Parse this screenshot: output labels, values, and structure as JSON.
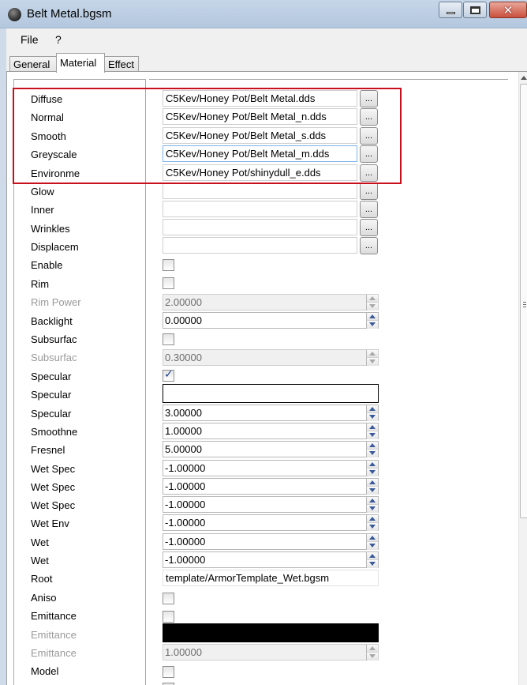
{
  "window": {
    "title": "Belt Metal.bgsm"
  },
  "menu": [
    "File",
    "?"
  ],
  "tabs": [
    "General",
    "Material",
    "Effect"
  ],
  "textures": [
    {
      "label": "Diffuse",
      "value": "C5Kev/Honey Pot/Belt Metal.dds"
    },
    {
      "label": "Normal",
      "value": "C5Kev/Honey Pot/Belt Metal_n.dds"
    },
    {
      "label": "Smooth",
      "value": "C5Kev/Honey Pot/Belt Metal_s.dds"
    },
    {
      "label": "Greyscale",
      "value": "C5Kev/Honey Pot/Belt Metal_m.dds"
    },
    {
      "label": "Environme",
      "value": "C5Kev/Honey Pot/shinydull_e.dds"
    },
    {
      "label": "Glow",
      "value": ""
    },
    {
      "label": "Inner",
      "value": ""
    },
    {
      "label": "Wrinkles",
      "value": ""
    },
    {
      "label": "Displacem",
      "value": ""
    }
  ],
  "browse_label": "...",
  "props": {
    "enable": {
      "label": "Enable",
      "checked": false
    },
    "rim": {
      "label": "Rim",
      "checked": false
    },
    "rim_power": {
      "label": "Rim Power",
      "value": "2.00000"
    },
    "backlight": {
      "label": "Backlight",
      "value": "0.00000"
    },
    "subsurfac_check": {
      "label": "Subsurfac",
      "checked": false
    },
    "subsurfac_value": {
      "label": "Subsurfac",
      "value": "0.30000"
    },
    "specular_check": {
      "label": "Specular",
      "checked": true
    },
    "specular_color": {
      "label": "Specular",
      "color": "#ffffff"
    },
    "specular_value": {
      "label": "Specular",
      "value": "3.00000"
    },
    "smoothne": {
      "label": "Smoothne",
      "value": "1.00000"
    },
    "fresnel": {
      "label": "Fresnel",
      "value": "5.00000"
    },
    "wet_spec_1": {
      "label": "Wet Spec",
      "value": "-1.00000"
    },
    "wet_spec_2": {
      "label": "Wet Spec",
      "value": "-1.00000"
    },
    "wet_spec_3": {
      "label": "Wet Spec",
      "value": "-1.00000"
    },
    "wet_env": {
      "label": "Wet Env",
      "value": "-1.00000"
    },
    "wet_1": {
      "label": "Wet",
      "value": "-1.00000"
    },
    "wet_2": {
      "label": "Wet",
      "value": "-1.00000"
    },
    "root": {
      "label": "Root",
      "value": "template/ArmorTemplate_Wet.bgsm"
    },
    "aniso": {
      "label": "Aniso",
      "checked": false
    },
    "emittance_check": {
      "label": "Emittance",
      "checked": false
    },
    "emittance_color": {
      "label": "Emittance",
      "color": "#000000"
    },
    "emittance_value": {
      "label": "Emittance",
      "value": "1.00000"
    },
    "model": {
      "label": "Model",
      "checked": false
    }
  },
  "colors": {
    "highlight": "#c8101d",
    "titlebar": "#b9cbe0"
  }
}
